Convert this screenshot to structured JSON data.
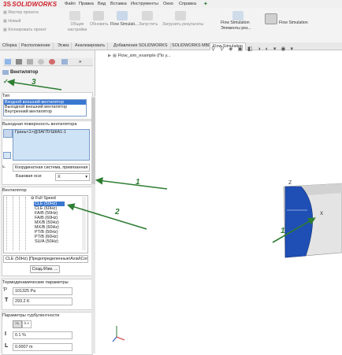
{
  "app": {
    "logo_text": "SOLIDWORKS",
    "logo_prefix": "3S"
  },
  "menu": [
    "Файл",
    "Правка",
    "Вид",
    "Вставка",
    "Инструменты",
    "Окно",
    "Справка"
  ],
  "ribbon_left": [
    "Мастер проекта",
    "Новый",
    "Клонировать проект"
  ],
  "ribbon_tools": {
    "general": "Общие настройки",
    "update": "Обновить",
    "flow_sim": "Flow Simulati...",
    "launch": "Запустить",
    "results": "Загрузить результаты",
    "elements": "Flow Simulation Элементы рез...",
    "flow_sim2": "Flow Simulation"
  },
  "tabs": [
    "Сборка",
    "Расположение",
    "Эскиз",
    "Анализировать",
    "Добавления SOLIDWORKS",
    "SOLIDWORKS MBD",
    "Flow Simulation"
  ],
  "active_tab": 6,
  "tree_item": "Flow_sim_example (По у...",
  "panel": {
    "title": "Вентилятор",
    "confirm_icon": "check-icon",
    "type_header": "Тип",
    "type_options": [
      "Входной внешний вентилятор",
      "Выходной внешний вентилятор",
      "Внутренний вентилятор"
    ],
    "type_selected": 0,
    "surface_header": "Выходная поверхность вентилятора",
    "surface_item": "Грань<1>@ЗАГЛУШКА1-1",
    "coord_system": "Координатная система, привязанная к п",
    "base_axis_label": "Базовая оси:",
    "base_axis_value": "X",
    "fan_header": "Вентилятор",
    "fan_tree_root": "Full Speed",
    "fan_items": [
      "CLE (50Hz)",
      "CLE (60Hz)",
      "FA/B (50Hz)",
      "FA/B (60Hz)",
      "MX/B (50Hz)",
      "MX/B (60Hz)",
      "PT/B (50Hz)",
      "PT/B (60Hz)",
      "SU/A (50Hz)"
    ],
    "fan_selected": 0,
    "fan_combo": "CLE (50Hz) [Предопределенные\\Axial\\Com",
    "create_button": "Созд./Изм. ...",
    "thermo_header": "Термодинамические параметры",
    "pressure": "101325 Pa",
    "temperature": "293.2 K",
    "temp_symbol": "T",
    "turb_header": "Параметры турбулентности",
    "intensity": "0.1 %",
    "length": "0.0007 m",
    "intensity_symbol": "I",
    "length_symbol": "L"
  },
  "annotations": [
    "1",
    "2",
    "3",
    "1"
  ],
  "colors": {
    "accent": "#3a77d1",
    "arrow": "#2e7d32",
    "fan_face": "#1f4fb5",
    "logo": "#d0202a"
  }
}
